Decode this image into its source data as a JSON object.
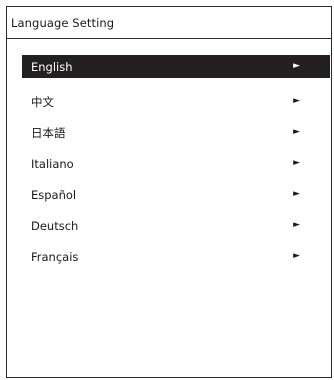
{
  "window": {
    "title": "Language Setting"
  },
  "languages": {
    "items": [
      {
        "label": "English",
        "selected": true
      },
      {
        "label": "中文",
        "selected": false
      },
      {
        "label": "日本語",
        "selected": false
      },
      {
        "label": "Italiano",
        "selected": false
      },
      {
        "label": "Español",
        "selected": false
      },
      {
        "label": "Deutsch",
        "selected": false
      },
      {
        "label": "Français",
        "selected": false
      }
    ],
    "arrow_icon": "play-right-icon",
    "arrow_glyph": "►",
    "selected_background": "#231f20",
    "selected_text_color": "#ffffff"
  }
}
